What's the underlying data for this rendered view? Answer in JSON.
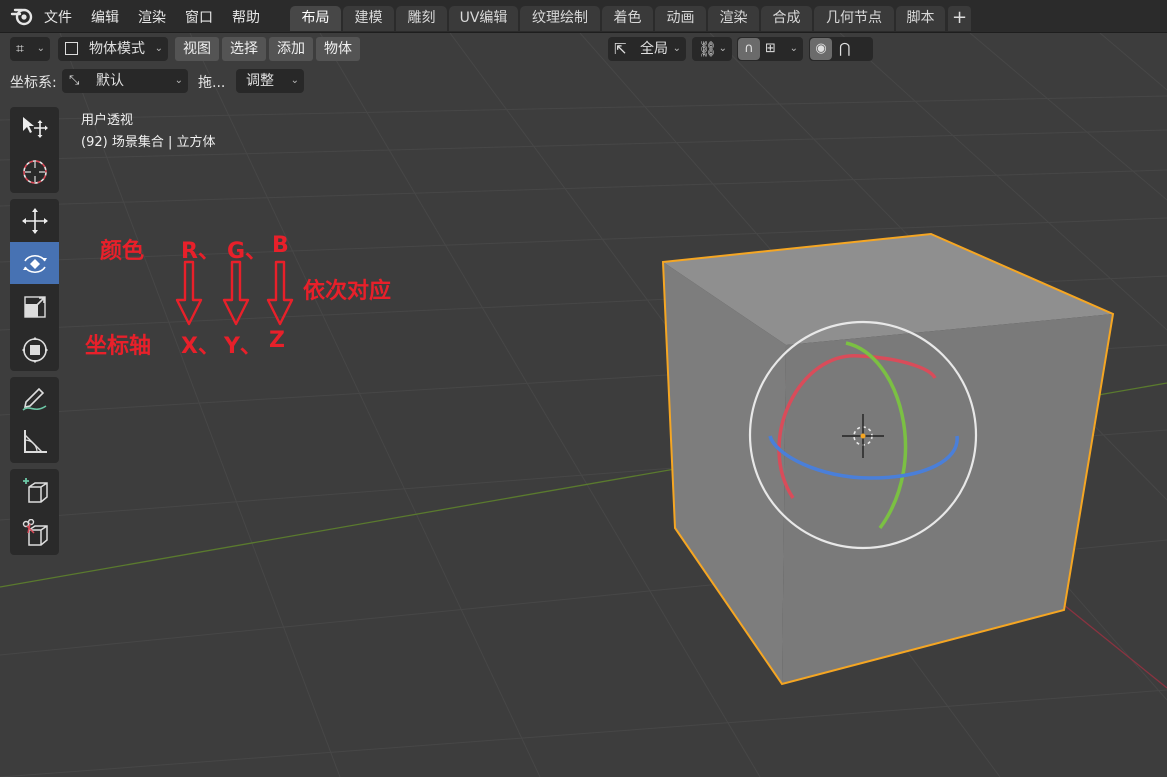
{
  "menu": [
    "文件",
    "编辑",
    "渲染",
    "窗口",
    "帮助"
  ],
  "tabs": [
    "布局",
    "建模",
    "雕刻",
    "UV编辑",
    "纹理绘制",
    "着色",
    "动画",
    "渲染",
    "合成",
    "几何节点",
    "脚本"
  ],
  "tab_add": "+",
  "header": {
    "mode": "物体模式",
    "menus": [
      "视图",
      "选择",
      "添加",
      "物体"
    ],
    "transform_orientation": "全局"
  },
  "toolsettings": {
    "coord_label": "坐标系:",
    "coord_value": "默认",
    "drag_label": "拖...",
    "adjust_label": "调整"
  },
  "viewport_info": {
    "view_name": "用户透视",
    "collection": "(92) 场景集合 | 立方体"
  },
  "annotation": {
    "color_label": "颜色",
    "rgb": "R、G、B",
    "r": "R、",
    "g": "G、",
    "b": "B",
    "corresponds": "依次对应",
    "axis_label": "坐标轴",
    "x": "X、",
    "y": "Y、",
    "z": "Z",
    "color": "#e8202a"
  },
  "colors": {
    "x_axis": "#d94c5a",
    "y_axis": "#7bc043",
    "z_axis": "#4a7fd9",
    "selection_outline": "#f5a623",
    "active_tool": "#4772b3"
  }
}
